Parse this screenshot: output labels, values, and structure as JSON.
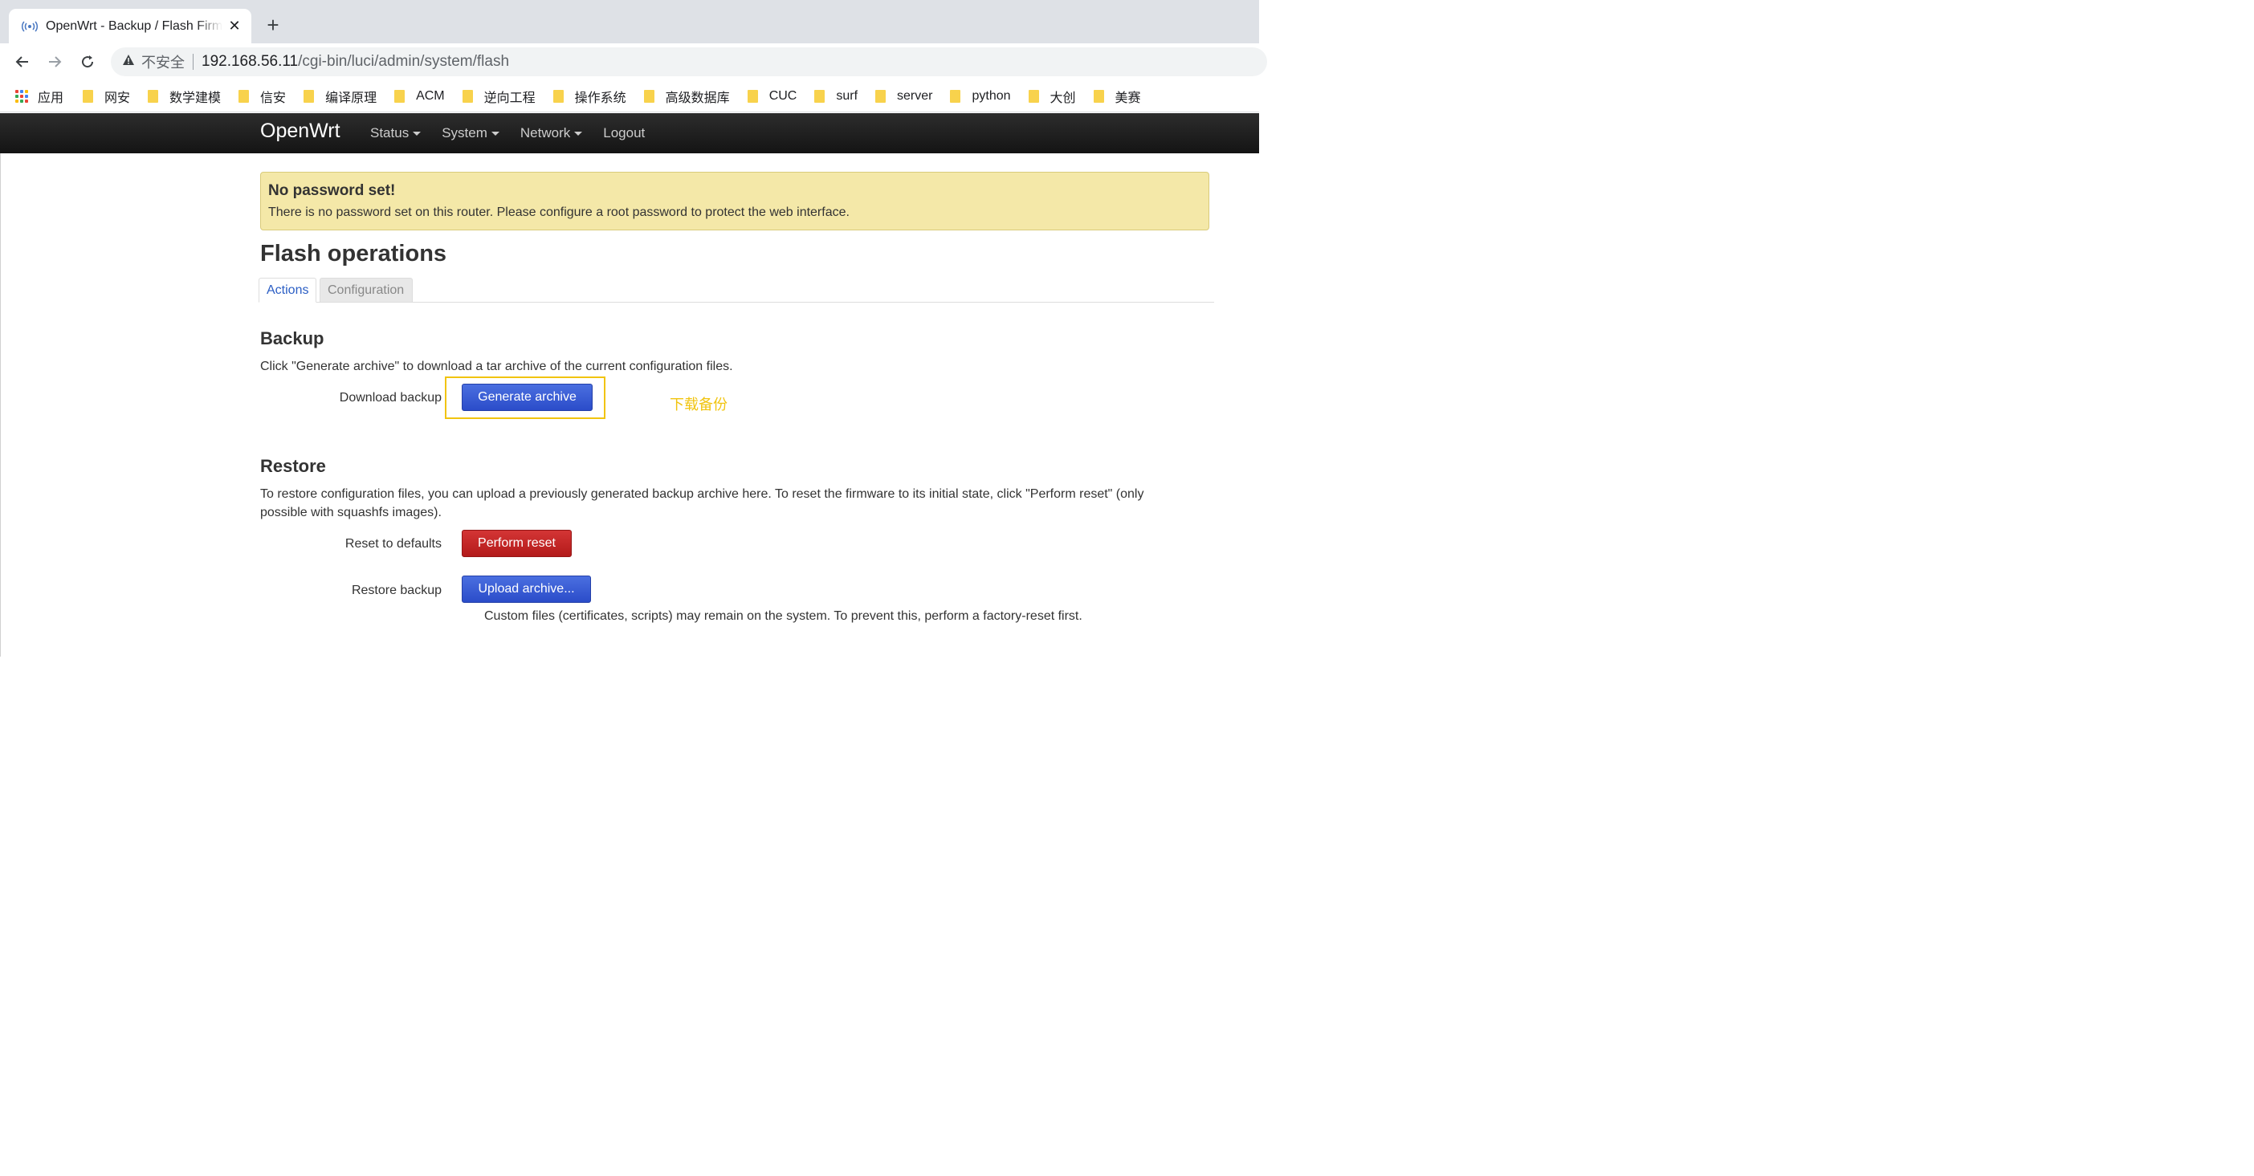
{
  "browser": {
    "tab_title": "OpenWrt - Backup / Flash Firm",
    "new_tab": "+",
    "close": "✕",
    "address": {
      "security_label": "不安全",
      "host": "192.168.56.11",
      "path": "/cgi-bin/luci/admin/system/flash"
    },
    "bookmarks": [
      "应用",
      "网安",
      "数学建模",
      "信安",
      "编译原理",
      "ACM",
      "逆向工程",
      "操作系统",
      "高级数据库",
      "CUC",
      "surf",
      "server",
      "python",
      "大创",
      "美赛"
    ]
  },
  "header": {
    "brand": "OpenWrt",
    "menu": [
      {
        "label": "Status",
        "dropdown": true
      },
      {
        "label": "System",
        "dropdown": true
      },
      {
        "label": "Network",
        "dropdown": true
      },
      {
        "label": "Logout",
        "dropdown": false
      }
    ]
  },
  "alert": {
    "title": "No password set!",
    "text": "There is no password set on this router. Please configure a root password to protect the web interface."
  },
  "page": {
    "title": "Flash operations",
    "tabs": [
      "Actions",
      "Configuration"
    ]
  },
  "backup": {
    "title": "Backup",
    "description": "Click \"Generate archive\" to download a tar archive of the current configuration files.",
    "label": "Download backup",
    "button": "Generate archive",
    "annotation": "下载备份"
  },
  "restore": {
    "title": "Restore",
    "description_line1": "To restore configuration files, you can upload a previously generated backup archive here. To reset the firmware to its initial state, click \"Perform reset\" (only",
    "description_line2": "possible with squashfs images).",
    "reset_label": "Reset to defaults",
    "reset_button": "Perform reset",
    "restore_label": "Restore backup",
    "upload_button": "Upload archive...",
    "note": "Custom files (certificates, scripts) may remain on the system. To prevent this, perform a factory-reset first."
  },
  "colors": {
    "annotation": "#f1c40f",
    "primary_button": "#2b4cc9",
    "danger_button": "#b31a1a",
    "alert_bg": "#f4e8a8",
    "header_bg": "#1f1f1f"
  }
}
